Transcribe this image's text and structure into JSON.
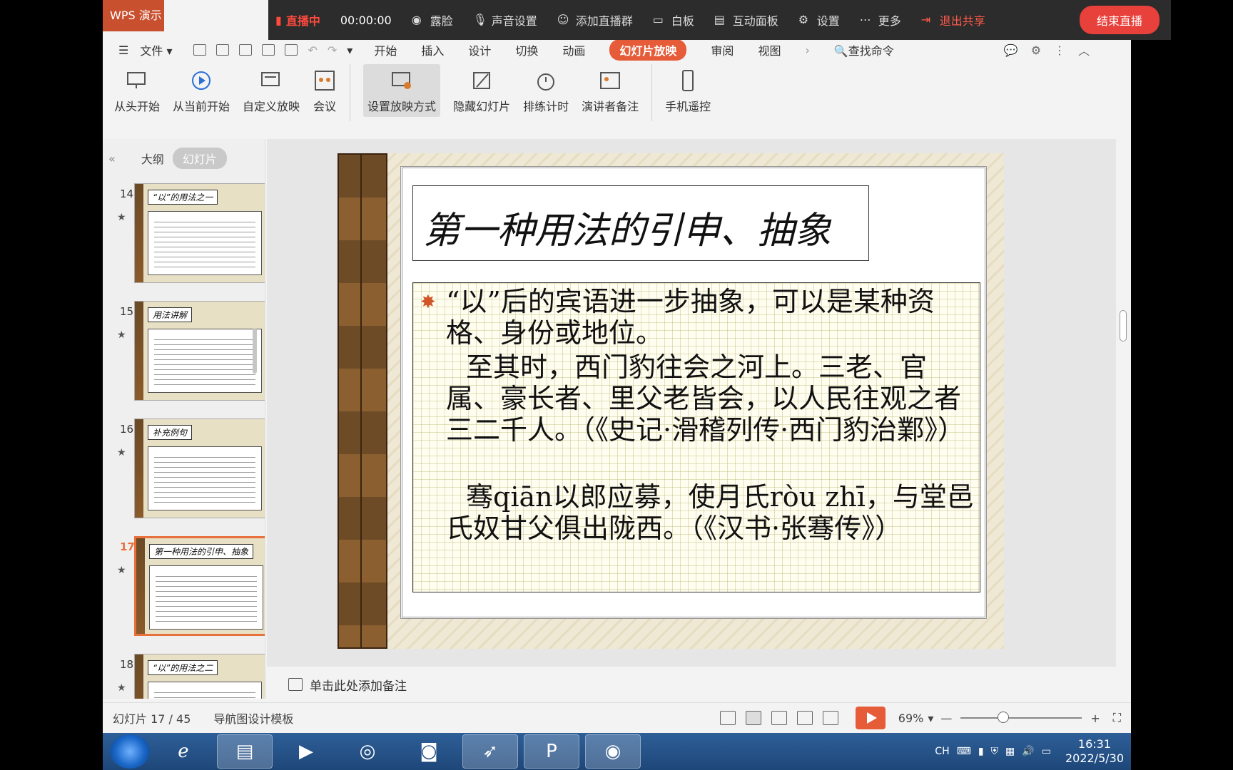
{
  "app": {
    "badge": "WPS 演示"
  },
  "live_bar": {
    "status": "直播中",
    "timer": "00:00:00",
    "items": [
      "露脸",
      "声音设置",
      "添加直播群",
      "白板",
      "互动面板",
      "设置",
      "更多"
    ],
    "exit_share": "退出共享",
    "end_live": "结束直播"
  },
  "menu": {
    "file": "文件",
    "tabs": [
      "开始",
      "插入",
      "设计",
      "切换",
      "动画",
      "幻灯片放映",
      "审阅",
      "视图"
    ],
    "active_tab": "幻灯片放映",
    "search": "查找命令"
  },
  "ribbon": {
    "buttons": [
      "从头开始",
      "从当前开始",
      "自定义放映",
      "会议",
      "设置放映方式",
      "隐藏幻灯片",
      "排练计时",
      "演讲者备注",
      "手机遥控"
    ]
  },
  "panel": {
    "tabs": [
      "大纲",
      "幻灯片"
    ],
    "collapse": "«",
    "thumbs": [
      {
        "num": "14",
        "title": "“以”的用法之一"
      },
      {
        "num": "15",
        "title": "用法讲解"
      },
      {
        "num": "16",
        "title": "补充例句"
      },
      {
        "num": "17",
        "title": "第一种用法的引申、抽象"
      },
      {
        "num": "18",
        "title": "“以”的用法之二"
      }
    ],
    "star": "★"
  },
  "slide": {
    "title": "第一种用法的引申、抽象",
    "bullet": "✸",
    "p1": "“以”后的宾语进一步抽象，可以是某种资格、身份或地位。",
    "p2": "至其时，西门豹往会之河上。三老、官属、豪长者、里父老皆会，以人民往观之者三二千人。（《史记·滑稽列传·西门豹治鄴》）",
    "p3": "骞qiān以郎应募，使月氏ròu zhī，与堂邑氏奴甘父俱出陇西。（《汉书·张骞传》）"
  },
  "notes": {
    "placeholder": "单击此处添加备注"
  },
  "status": {
    "slide_count": "幻灯片 17 / 45",
    "template": "导航图设计模板",
    "zoom": "69%",
    "zoom_level": 0.35
  },
  "taskbar": {
    "ime": "CH",
    "time": "16:31",
    "date": "2022/5/30"
  }
}
